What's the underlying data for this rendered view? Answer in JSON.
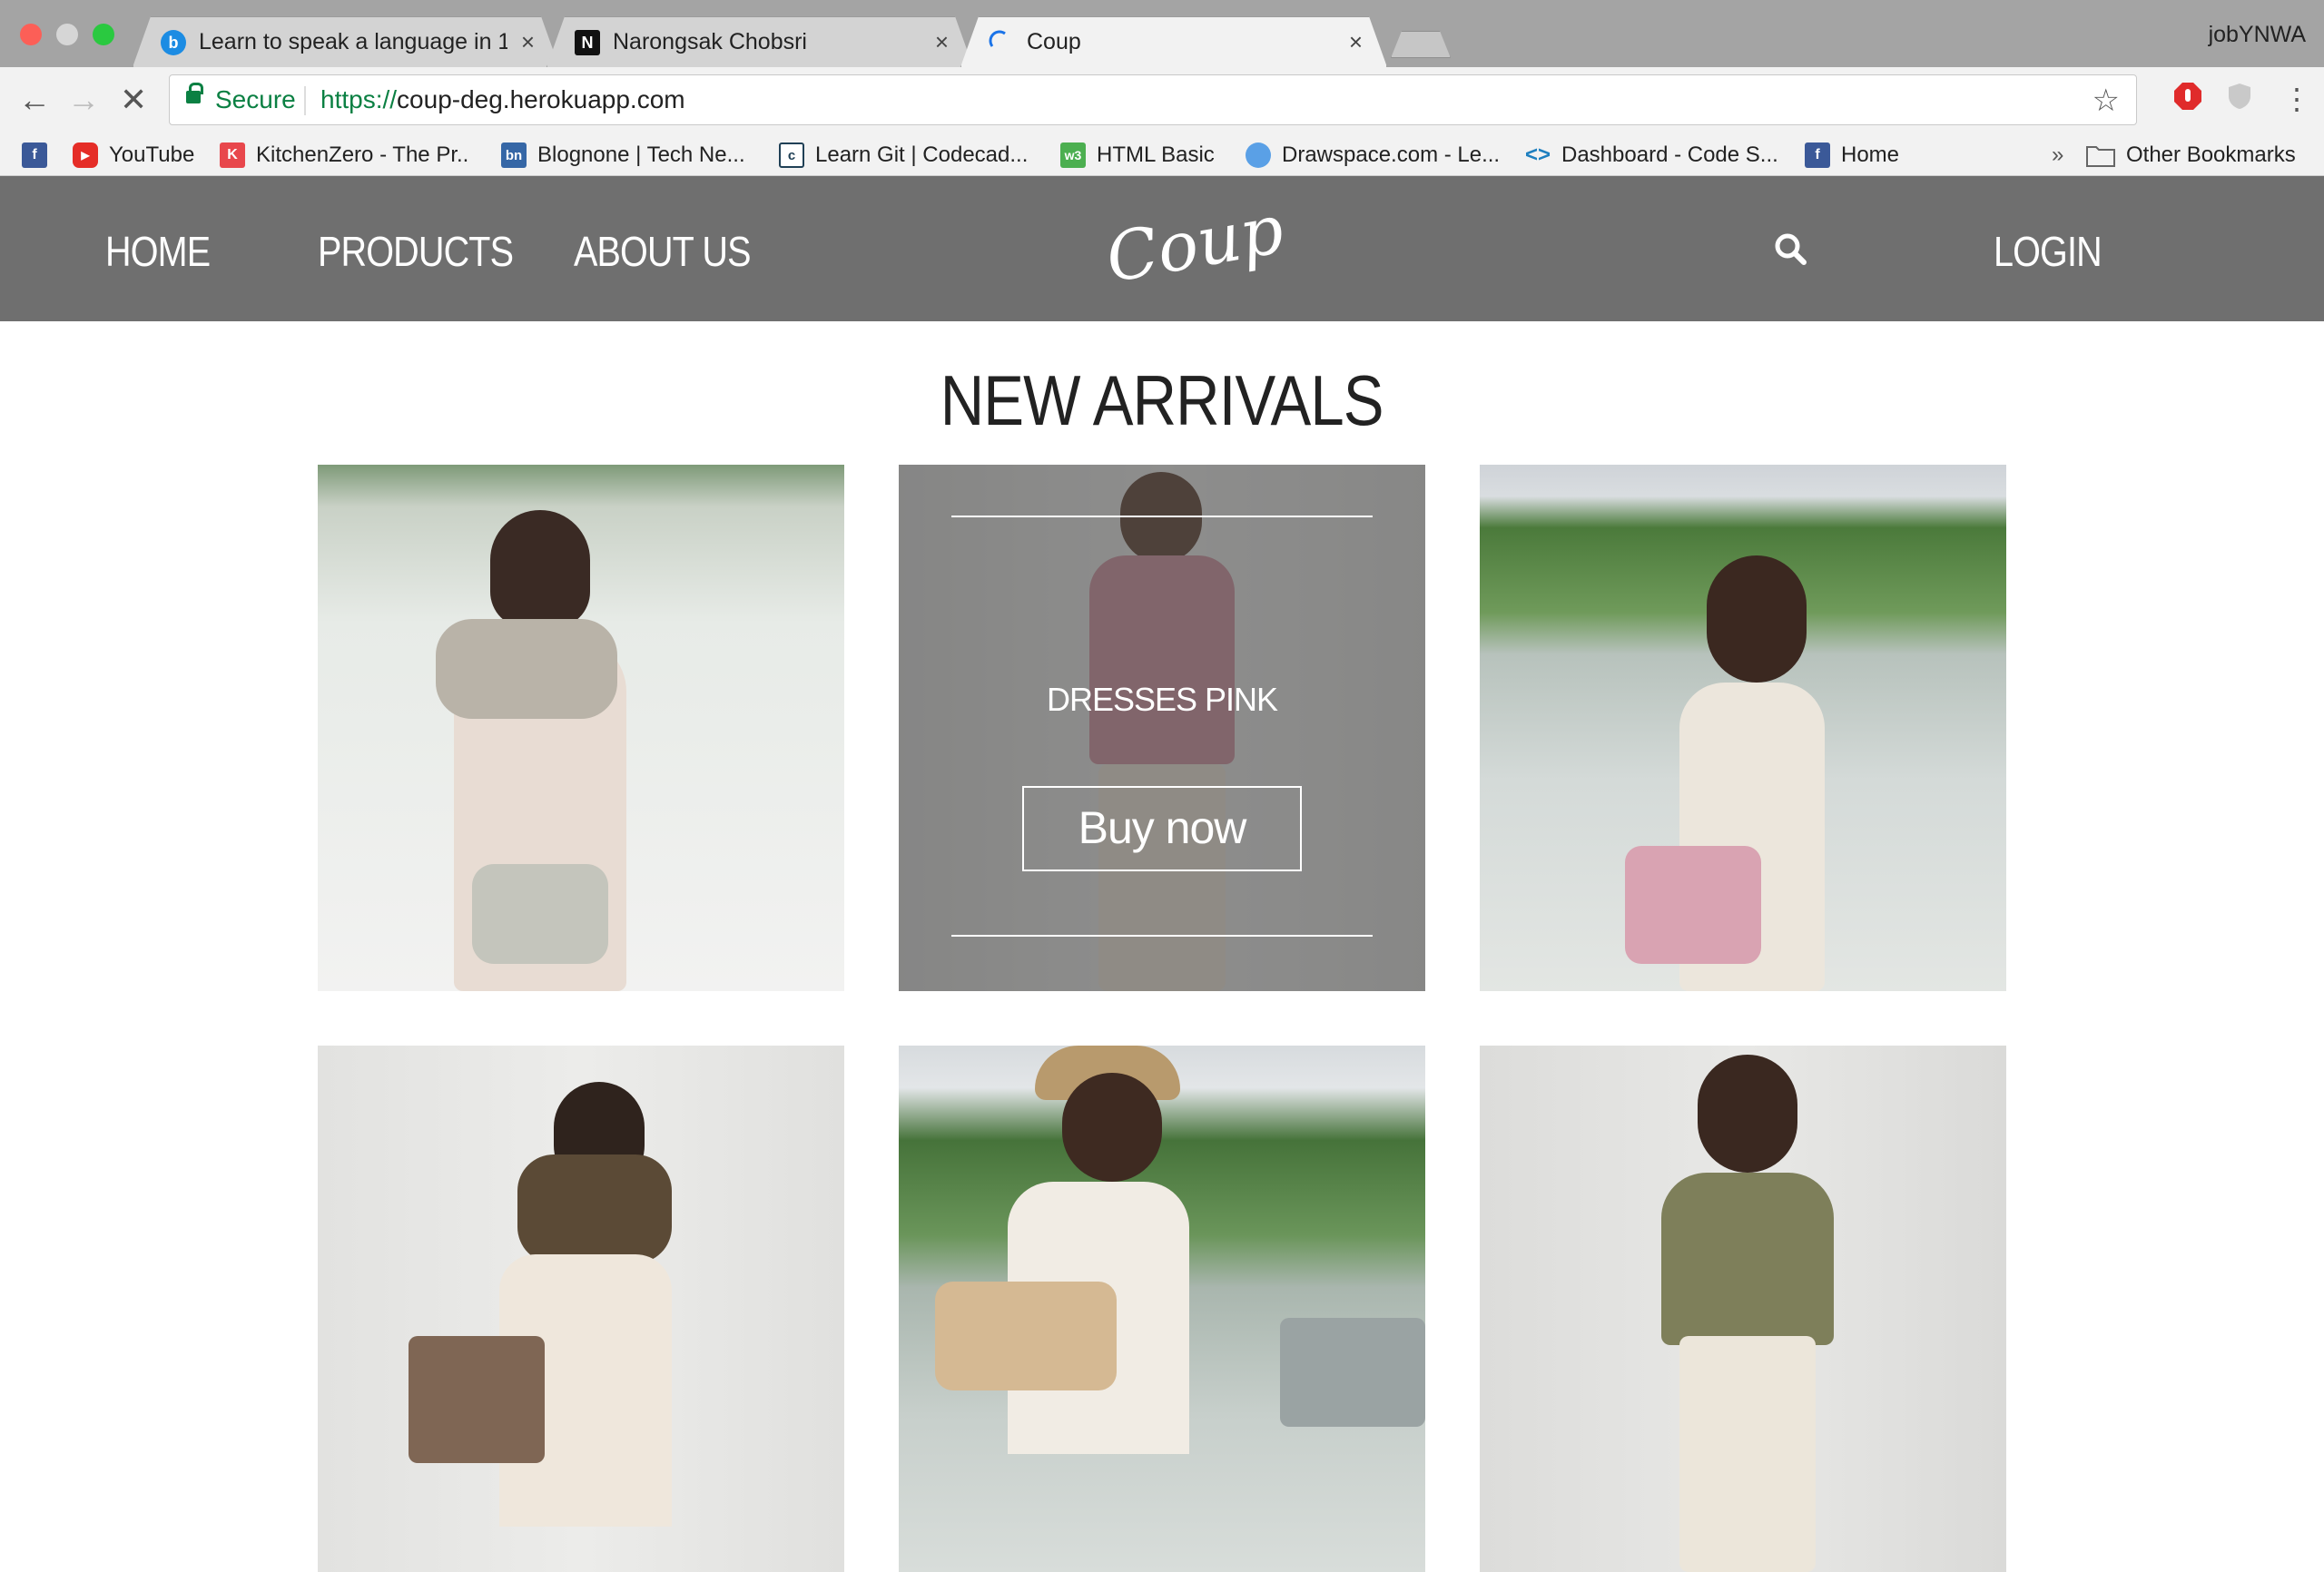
{
  "browser": {
    "tabs": [
      {
        "title": "Learn to speak a language in 1(",
        "favicon": "b"
      },
      {
        "title": "Narongsak Chobsri",
        "favicon": "N"
      },
      {
        "title": "Coup",
        "favicon": "loading"
      }
    ],
    "profile_name": "jobYNWA",
    "secure_label": "Secure",
    "url_scheme": "https://",
    "url_host": "coup-deg.herokuapp.com",
    "bookmarks": [
      {
        "label": "",
        "icon": "facebook-icon"
      },
      {
        "label": "YouTube",
        "icon": "youtube-icon"
      },
      {
        "label": "KitchenZero - The Pr..",
        "icon": "K"
      },
      {
        "label": "Blognone | Tech Ne...",
        "icon": "bn"
      },
      {
        "label": "Learn Git | Codecad...",
        "icon": "c"
      },
      {
        "label": "HTML Basic",
        "icon": "w3"
      },
      {
        "label": "Drawspace.com - Le...",
        "icon": "drawspace-icon"
      },
      {
        "label": "Dashboard - Code S...",
        "icon": "code-icon"
      },
      {
        "label": "Home",
        "icon": "facebook-icon"
      }
    ],
    "bookmarks_overflow": "»",
    "other_bookmarks": "Other Bookmarks"
  },
  "site": {
    "nav": {
      "home": "HOME",
      "products": "PRODUCTS",
      "about": "ABOUT US",
      "logo": "Coup",
      "login": "LOGIN"
    },
    "heading": "NEW ARRIVALS",
    "featured": {
      "title": "DRESSES PINK",
      "button": "Buy now"
    }
  },
  "colors": {
    "nav_bg": "#6f6f6f",
    "secure_green": "#0b8043"
  }
}
